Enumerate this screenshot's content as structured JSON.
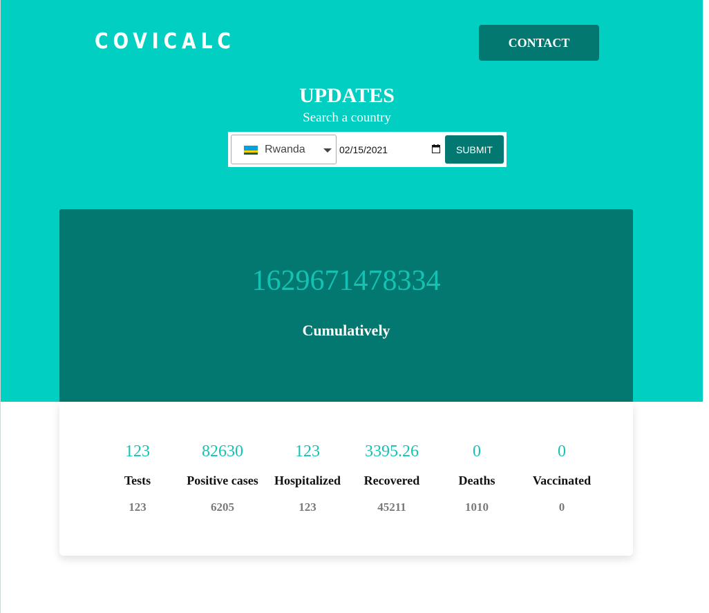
{
  "header": {
    "logo": "COVICALC",
    "contact_label": "CONTACT"
  },
  "search": {
    "title": "UPDATES",
    "subtitle": "Search a country",
    "country": "Rwanda",
    "flag_icon": "rwanda-flag-icon",
    "date": "02/15/2021",
    "submit_label": "SUBMIT"
  },
  "total": {
    "value": "1629671478334",
    "label": "Cumulatively"
  },
  "stats": [
    {
      "value": "123",
      "label": "Tests",
      "sub": "123"
    },
    {
      "value": "82630",
      "label": "Positive cases",
      "sub": "6205"
    },
    {
      "value": "123",
      "label": "Hospitalized",
      "sub": "123"
    },
    {
      "value": "3395.26",
      "label": "Recovered",
      "sub": "45211"
    },
    {
      "value": "0",
      "label": "Deaths",
      "sub": "1010"
    },
    {
      "value": "0",
      "label": "Vaccinated",
      "sub": "0"
    }
  ],
  "colors": {
    "primary": "#00cfc1",
    "dark": "#037870",
    "accent_text": "#14c2b4"
  }
}
